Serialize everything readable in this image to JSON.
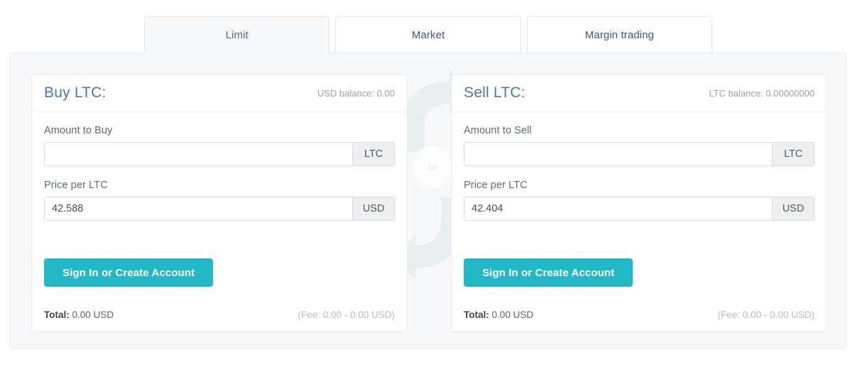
{
  "tabs": [
    {
      "label": "Limit",
      "active": true
    },
    {
      "label": "Market",
      "active": false
    },
    {
      "label": "Margin trading",
      "active": false
    }
  ],
  "decoration": {
    "or_label": "or",
    "icon": "exchange-arrows-icon",
    "arrow_color": "#e9eef0"
  },
  "buy_panel": {
    "title": "Buy LTC:",
    "balance": "USD balance: 0.00",
    "amount_label": "Amount to Buy",
    "amount_value": "",
    "amount_placeholder": "",
    "amount_unit": "LTC",
    "price_label": "Price per LTC",
    "price_value": "42.588",
    "price_unit": "USD",
    "submit_label": "Sign In or Create Account",
    "total_label": "Total:",
    "total_value": "0.00 USD",
    "fee_text": "(Fee: 0.00 - 0.00 USD)"
  },
  "sell_panel": {
    "title": "Sell LTC:",
    "balance": "LTC balance: 0.00000000",
    "amount_label": "Amount to Sell",
    "amount_value": "",
    "amount_placeholder": "",
    "amount_unit": "LTC",
    "price_label": "Price per LTC",
    "price_value": "42.404",
    "price_unit": "USD",
    "submit_label": "Sign In or Create Account",
    "total_label": "Total:",
    "total_value": "0.00 USD",
    "fee_text": "(Fee: 0.00 - 0.00 USD)"
  },
  "colors": {
    "accent": "#22b8c6",
    "title_blue": "#4a77b5",
    "tab_text": "#3c5a80",
    "panel_bg": "#f7f8fa"
  }
}
